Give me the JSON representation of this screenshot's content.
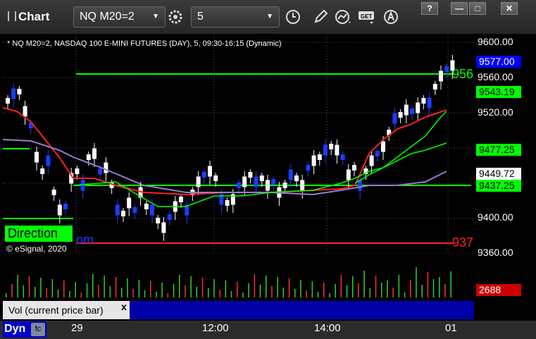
{
  "window": {
    "title": "Chart",
    "symbol": "NQ M20=2",
    "interval": "5",
    "buttons": {
      "help": "?",
      "minimize": "—",
      "maximize": "□",
      "close": "✕"
    }
  },
  "toolbar_icons": [
    "settings-icon",
    "clock-icon",
    "pencil-icon",
    "study-icon",
    "get-icon",
    "drawing-icon"
  ],
  "chart": {
    "header": "* NQ M20=2, NASDAQ 100 E-MINI FUTURES (DAY), 5, 09:30-16:15 (Dynamic)",
    "copyright": "© eSignal, 2020",
    "direction_label": "Direction",
    "com_fragment": "om",
    "resistance_label": "956",
    "support_label": "937",
    "colors": {
      "bull": "#ffffff",
      "bear": "#1a3cff",
      "green_line": "#00ff00",
      "red_line": "#ff2020",
      "purple_line": "#9a7bd0",
      "accent": "#00ff00"
    }
  },
  "price_axis": {
    "labels": [
      "9600.00",
      "9560.00",
      "9520.00",
      "9400.00",
      "9360.00"
    ],
    "tags": [
      {
        "value": "9577.00",
        "bg": "#0000ff",
        "fg": "#ffffff"
      },
      {
        "value": "9543.19",
        "bg": "#00ff00",
        "fg": "#000000"
      },
      {
        "value": "9477.25",
        "bg": "#00ff00",
        "fg": "#000000"
      },
      {
        "value": "9449.72",
        "bg": "#ffffff",
        "fg": "#000000"
      },
      {
        "value": "9437.25",
        "bg": "#00ff00",
        "fg": "#000000"
      }
    ]
  },
  "volume": {
    "label": "Vol (current price bar)",
    "close": "x",
    "current": "2688"
  },
  "time_axis": {
    "labels": [
      "29",
      "12:00",
      "14:00",
      "01"
    ],
    "dyn": "Dyn"
  }
}
